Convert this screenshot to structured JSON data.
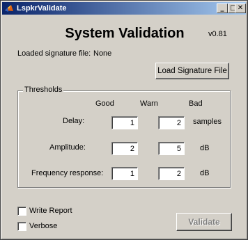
{
  "window": {
    "title": "LspkrValidate",
    "minimize_glyph": "_",
    "maximize_glyph": "□",
    "close_glyph": "✕"
  },
  "header": {
    "title": "System Validation",
    "version": "v0.81"
  },
  "signature": {
    "label": "Loaded signature file:",
    "value": "None",
    "load_button": "Load Signature File"
  },
  "thresholds": {
    "group_label": "Thresholds",
    "columns": [
      "Good",
      "Warn",
      "Bad"
    ],
    "rows": [
      {
        "label": "Delay:",
        "warn": "1",
        "bad": "2",
        "unit": "samples"
      },
      {
        "label": "Amplitude:",
        "warn": "2",
        "bad": "5",
        "unit": "dB"
      },
      {
        "label": "Frequency response:",
        "warn": "1",
        "bad": "2",
        "unit": "dB"
      }
    ]
  },
  "options": {
    "write_report": {
      "label": "Write Report",
      "checked": false
    },
    "verbose": {
      "label": "Verbose",
      "checked": false
    }
  },
  "actions": {
    "validate_label": "Validate",
    "validate_enabled": false
  },
  "colors": {
    "titlebar_start": "#0a246a",
    "titlebar_end": "#a6caf0",
    "face": "#d4d0c8",
    "disabled_text": "#808080"
  }
}
